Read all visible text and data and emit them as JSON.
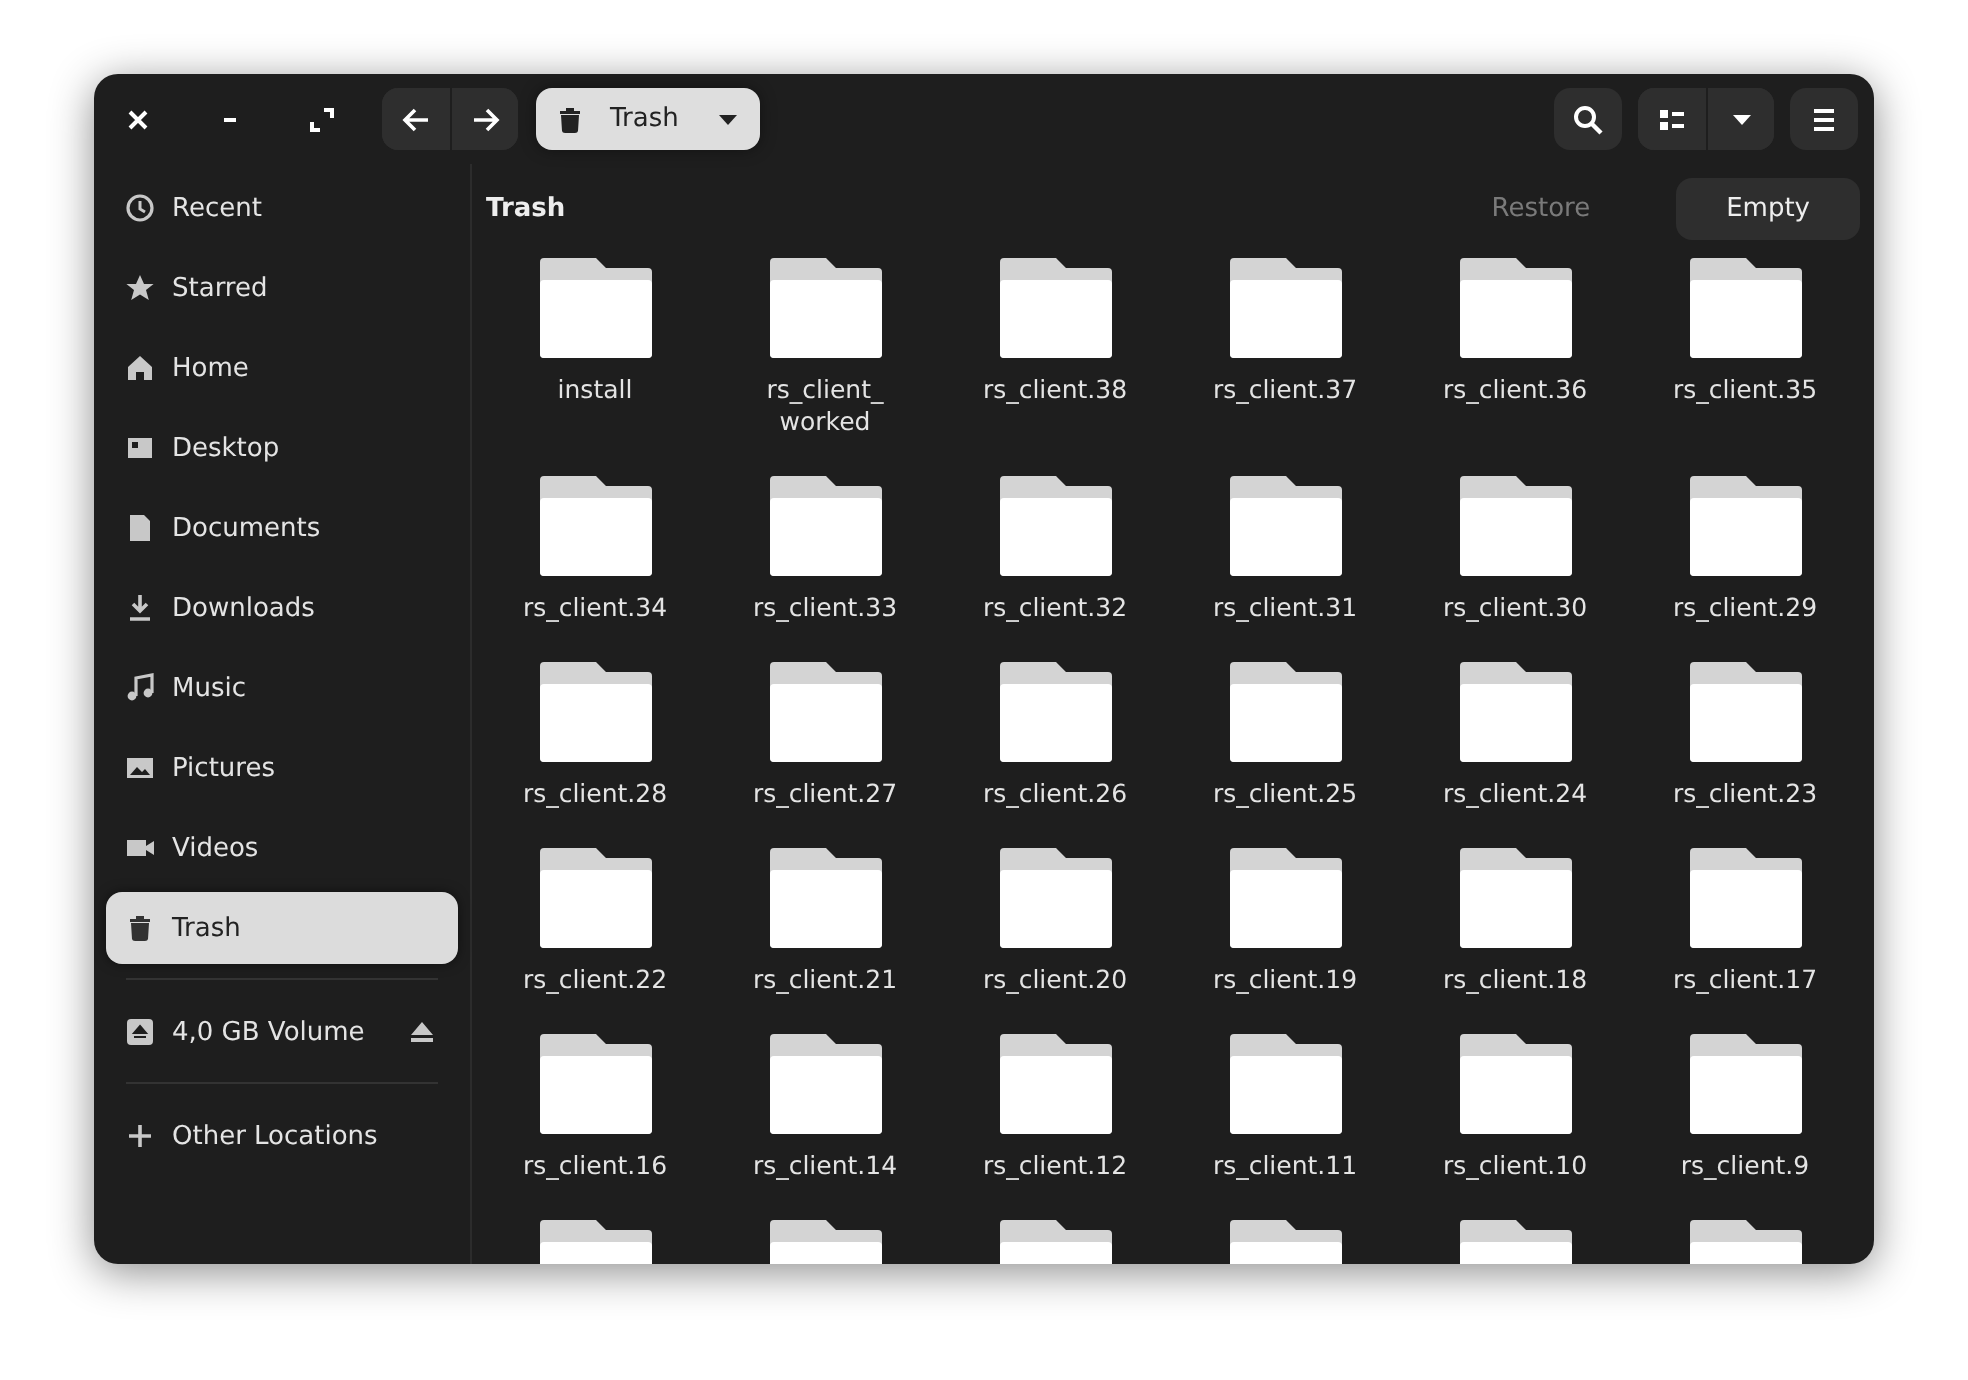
{
  "header": {
    "path": {
      "label": "Trash",
      "kind": "trash"
    }
  },
  "sidebar": {
    "items": [
      {
        "label": "Recent",
        "kind": "recent",
        "selected": false
      },
      {
        "label": "Starred",
        "kind": "starred",
        "selected": false
      },
      {
        "label": "Home",
        "kind": "home",
        "selected": false
      },
      {
        "label": "Desktop",
        "kind": "desktop",
        "selected": false
      },
      {
        "label": "Documents",
        "kind": "documents",
        "selected": false
      },
      {
        "label": "Downloads",
        "kind": "downloads",
        "selected": false
      },
      {
        "label": "Music",
        "kind": "music",
        "selected": false
      },
      {
        "label": "Pictures",
        "kind": "pictures",
        "selected": false
      },
      {
        "label": "Videos",
        "kind": "videos",
        "selected": false
      },
      {
        "label": "Trash",
        "kind": "trash",
        "selected": true
      }
    ],
    "devices": [
      {
        "label": "4,0 GB Volume",
        "kind": "drive",
        "ejectable": true,
        "selected": false
      }
    ],
    "other": [
      {
        "label": "Other Locations",
        "kind": "add",
        "selected": false
      }
    ]
  },
  "content": {
    "title": "Trash",
    "actions": [
      {
        "label": "Restore",
        "disabled": true
      },
      {
        "label": "Empty",
        "disabled": false
      }
    ],
    "items": [
      {
        "kind": "folder",
        "name": "install"
      },
      {
        "kind": "folder",
        "name": "rs_client_\nworked"
      },
      {
        "kind": "folder",
        "name": "rs_client.38"
      },
      {
        "kind": "folder",
        "name": "rs_client.37"
      },
      {
        "kind": "folder",
        "name": "rs_client.36"
      },
      {
        "kind": "folder",
        "name": "rs_client.35"
      },
      {
        "kind": "folder",
        "name": "rs_client.34"
      },
      {
        "kind": "folder",
        "name": "rs_client.33"
      },
      {
        "kind": "folder",
        "name": "rs_client.32"
      },
      {
        "kind": "folder",
        "name": "rs_client.31"
      },
      {
        "kind": "folder",
        "name": "rs_client.30"
      },
      {
        "kind": "folder",
        "name": "rs_client.29"
      },
      {
        "kind": "folder",
        "name": "rs_client.28"
      },
      {
        "kind": "folder",
        "name": "rs_client.27"
      },
      {
        "kind": "folder",
        "name": "rs_client.26"
      },
      {
        "kind": "folder",
        "name": "rs_client.25"
      },
      {
        "kind": "folder",
        "name": "rs_client.24"
      },
      {
        "kind": "folder",
        "name": "rs_client.23"
      },
      {
        "kind": "folder",
        "name": "rs_client.22"
      },
      {
        "kind": "folder",
        "name": "rs_client.21"
      },
      {
        "kind": "folder",
        "name": "rs_client.20"
      },
      {
        "kind": "folder",
        "name": "rs_client.19"
      },
      {
        "kind": "folder",
        "name": "rs_client.18"
      },
      {
        "kind": "folder",
        "name": "rs_client.17"
      },
      {
        "kind": "folder",
        "name": "rs_client.16"
      },
      {
        "kind": "folder",
        "name": "rs_client.14"
      },
      {
        "kind": "folder",
        "name": "rs_client.12"
      },
      {
        "kind": "folder",
        "name": "rs_client.11"
      },
      {
        "kind": "folder",
        "name": "rs_client.10"
      },
      {
        "kind": "folder",
        "name": "rs_client.9"
      },
      {
        "kind": "folder"
      },
      {
        "kind": "folder"
      },
      {
        "kind": "folder"
      },
      {
        "kind": "folder"
      },
      {
        "kind": "folder"
      },
      {
        "kind": "folder"
      }
    ]
  }
}
